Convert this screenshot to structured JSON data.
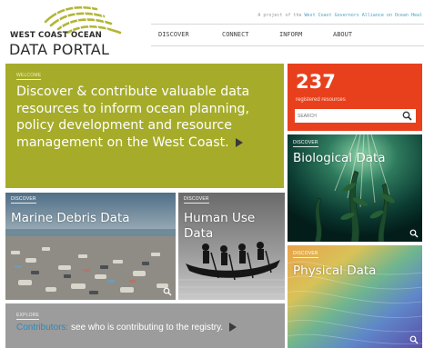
{
  "brand": {
    "logo_line1": "WEST COAST OCEAN",
    "logo_line2": "DATA PORTAL"
  },
  "header": {
    "tagline_prefix": "A project of the",
    "tagline_link": "West Coast Governors Alliance on Ocean Heal",
    "nav": [
      "DISCOVER",
      "CONNECT",
      "INFORM",
      "ABOUT"
    ]
  },
  "welcome": {
    "tag": "WELCOME",
    "text": "Discover & contribute valuable data resources to inform ocean planning, policy development and resource management on the West Coast."
  },
  "registry": {
    "count": "237",
    "label": "registered resources",
    "search_placeholder": "SEARCH"
  },
  "tiles": {
    "biological": {
      "tag": "DISCOVER",
      "title": "Biological Data"
    },
    "debris": {
      "tag": "DISCOVER",
      "title": "Marine Debris Data"
    },
    "human": {
      "tag": "DISCOVER",
      "title": "Human Use Data"
    },
    "physical": {
      "tag": "DISCOVER",
      "title": "Physical Data"
    }
  },
  "explore": {
    "tag": "EXPLORE",
    "link": "Contributors:",
    "text": " see who is contributing to the registry."
  },
  "colors": {
    "olive": "#a6ac2a",
    "orange": "#e8401c",
    "link_blue": "#2f88b8",
    "grey": "#9c9c9c"
  },
  "icons": [
    "waves-logo-icon",
    "search-icon",
    "zoom-icon",
    "arrow-right-icon"
  ]
}
